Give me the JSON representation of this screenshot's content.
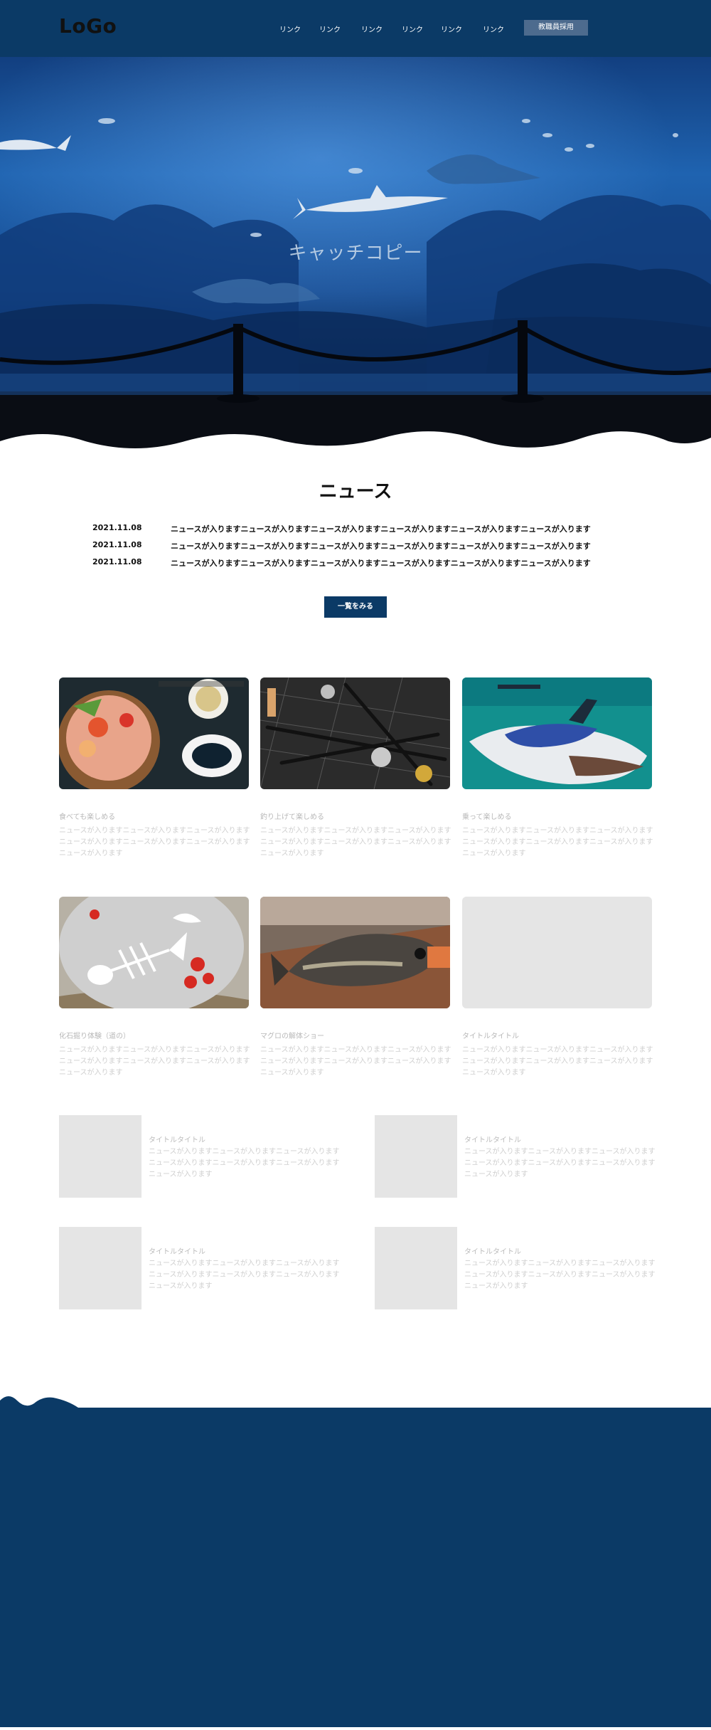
{
  "header": {
    "logo": "LoGo",
    "nav_links": [
      "リンク",
      "リンク",
      "リンク",
      "リンク",
      "リンク",
      "リンク"
    ],
    "recruit_button": "教職員採用",
    "background_color": "#0b3a66"
  },
  "hero": {
    "catch_copy": "キャッチコピー"
  },
  "news": {
    "title": "ニュース",
    "items": [
      {
        "date": "2021.11.08",
        "text": "ニュースが入りますニュースが入りますニュースが入りますニュースが入りますニュースが入りますニュースが入ります"
      },
      {
        "date": "2021.11.08",
        "text": "ニュースが入りますニュースが入りますニュースが入りますニュースが入りますニュースが入りますニュースが入ります"
      },
      {
        "date": "2021.11.08",
        "text": "ニュースが入りますニュースが入りますニュースが入りますニュースが入りますニュースが入りますニュースが入ります"
      }
    ],
    "more_button": "一覧をみる"
  },
  "cards": [
    {
      "image": "seafood-bowl-photo",
      "title": "食べても楽しめる",
      "body": "ニュースが入りますニュースが入りますニュースが入りますニュースが入りますニュースが入りますニュースが入りますニュースが入ります"
    },
    {
      "image": "fishing-rods-photo",
      "title": "釣り上げて楽しめる",
      "body": "ニュースが入りますニュースが入りますニュースが入りますニュースが入りますニュースが入りますニュースが入りますニュースが入ります"
    },
    {
      "image": "jet-ski-photo",
      "title": "乗って楽しめる",
      "body": "ニュースが入りますニュースが入りますニュースが入りますニュースが入りますニュースが入りますニュースが入りますニュースが入ります"
    },
    {
      "image": "fish-bone-sculpture-photo",
      "title": "化石掘り体験（道の）",
      "body": "ニュースが入りますニュースが入りますニュースが入りますニュースが入りますニュースが入りますニュースが入りますニュースが入ります"
    },
    {
      "image": "tuna-photo",
      "title": "マグロの解体ショー",
      "body": "ニュースが入りますニュースが入りますニュースが入りますニュースが入りますニュースが入りますニュースが入りますニュースが入ります"
    },
    {
      "image": "placeholder",
      "title": "タイトルタイトル",
      "body": "ニュースが入りますニュースが入りますニュースが入りますニュースが入りますニュースが入りますニュースが入りますニュースが入ります"
    }
  ],
  "items": [
    {
      "title": "タイトルタイトル",
      "body": "ニュースが入りますニュースが入りますニュースが入りますニュースが入りますニュースが入りますニュースが入りますニュースが入ります"
    },
    {
      "title": "タイトルタイトル",
      "body": "ニュースが入りますニュースが入りますニュースが入りますニュースが入りますニュースが入りますニュースが入りますニュースが入ります"
    },
    {
      "title": "タイトルタイトル",
      "body": "ニュースが入りますニュースが入りますニュースが入りますニュースが入りますニュースが入りますニュースが入りますニュースが入ります"
    },
    {
      "title": "タイトルタイトル",
      "body": "ニュースが入りますニュースが入りますニュースが入りますニュースが入りますニュースが入りますニュースが入りますニュースが入ります"
    }
  ],
  "footer": {
    "background_color": "#0b3a66"
  }
}
